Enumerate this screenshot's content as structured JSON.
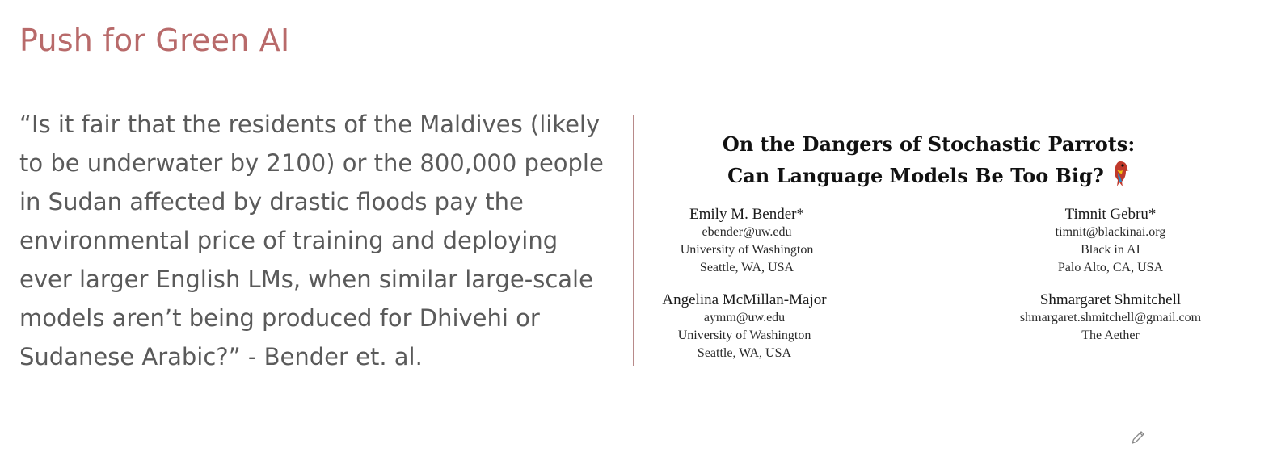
{
  "slide": {
    "title": "Push for Green AI",
    "quote": "“Is it fair that the residents of the Maldives (likely to be underwater by 2100) or the 800,000 people in Sudan affected by drastic floods pay the environmental price of training and deploying ever larger English LMs, when similar large-scale models aren’t being produced for Dhivehi or Sudanese Arabic?” - Bender et. al."
  },
  "paper": {
    "title_line1": "On the Dangers of Stochastic Parrots:",
    "title_line2": "Can Language Models Be Too Big?",
    "title_icon": "parrot-icon",
    "authors": [
      {
        "name": "Emily M. Bender*",
        "email": "ebender@uw.edu",
        "affiliation": "University of Washington",
        "location": "Seattle, WA, USA"
      },
      {
        "name": "Timnit Gebru*",
        "email": "timnit@blackinai.org",
        "affiliation": "Black in AI",
        "location": "Palo Alto, CA, USA"
      },
      {
        "name": "Angelina McMillan-Major",
        "email": "aymm@uw.edu",
        "affiliation": "University of Washington",
        "location": "Seattle, WA, USA"
      },
      {
        "name": "Shmargaret Shmitchell",
        "email": "shmargaret.shmitchell@gmail.com",
        "affiliation": "The Aether"
      }
    ]
  },
  "overlay": {
    "pen_icon": "pen-icon"
  },
  "colors": {
    "title": "#b86a6a",
    "quote_text": "#5a5a5a",
    "card_border": "#b88a8a",
    "background": "#ffffff"
  }
}
